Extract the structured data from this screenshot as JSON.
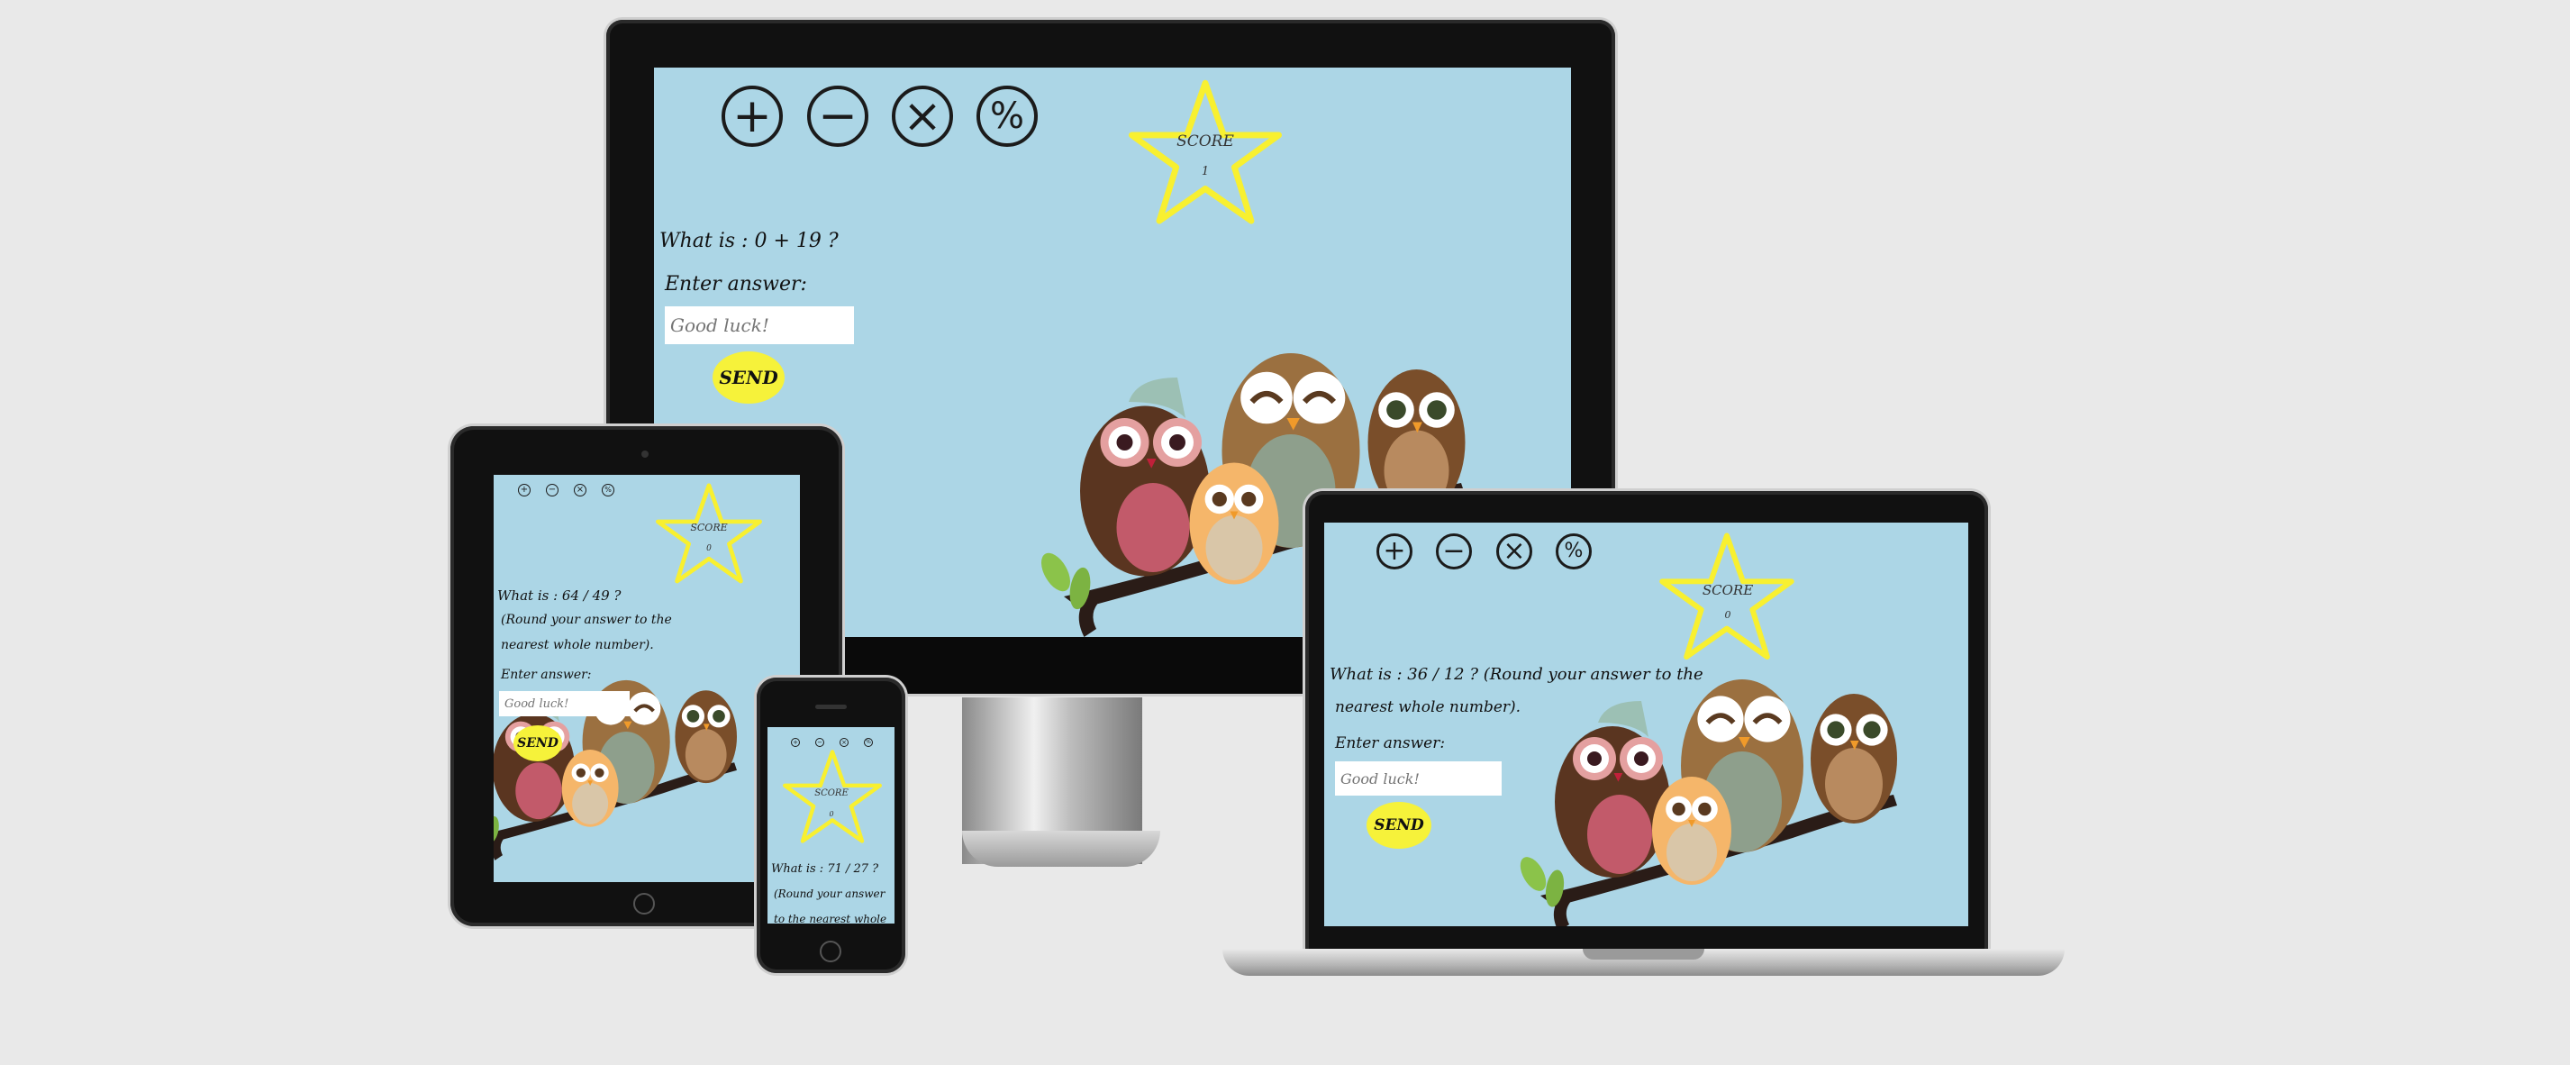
{
  "colors": {
    "background": "#e9e9e9",
    "screen": "#acd6e6",
    "star": "#f8f030",
    "send": "#f6f23a"
  },
  "operators": [
    {
      "symbol": "+",
      "icon": "plus-icon"
    },
    {
      "symbol": "−",
      "icon": "minus-icon"
    },
    {
      "symbol": "×",
      "icon": "multiply-icon"
    },
    {
      "symbol": "%",
      "icon": "percent-icon"
    }
  ],
  "desktop": {
    "score_label": "SCORE",
    "score_value": "1",
    "question": "What is : 0 + 19 ?",
    "enter_label": "Enter answer:",
    "placeholder": "Good luck!",
    "send_label": "SEND"
  },
  "tablet": {
    "score_label": "SCORE",
    "score_value": "0",
    "question_line1": "What is : 64 / 49 ?",
    "question_line2": "(Round your answer to the",
    "question_line3": "nearest whole number).",
    "enter_label": "Enter answer:",
    "placeholder": "Good luck!",
    "send_label": "SEND"
  },
  "phone": {
    "score_label": "SCORE",
    "score_value": "0",
    "question_line1": "What is : 71 / 27 ?",
    "question_line2": "(Round your answer",
    "question_line3": "to the nearest whole"
  },
  "laptop": {
    "score_label": "SCORE",
    "score_value": "0",
    "question_line1": "What is : 36 / 12 ? (Round your answer to the",
    "question_line2": "nearest whole number).",
    "enter_label": "Enter answer:",
    "placeholder": "Good luck!",
    "send_label": "SEND"
  }
}
